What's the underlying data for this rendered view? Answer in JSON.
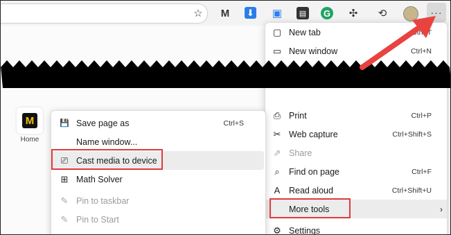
{
  "toolbar": {
    "icons": [
      {
        "name": "star-add-icon",
        "glyph": "☆"
      },
      {
        "name": "mail-icon",
        "glyph": "M"
      },
      {
        "name": "download-ext-icon",
        "glyph": "⬇"
      },
      {
        "name": "screenshot-ext-icon",
        "glyph": "▣"
      },
      {
        "name": "dark-ext-icon",
        "glyph": "▤"
      },
      {
        "name": "grammarly-icon",
        "glyph": "G"
      },
      {
        "name": "extensions-icon",
        "glyph": "✣"
      },
      {
        "name": "history-icon",
        "glyph": "⟲"
      }
    ],
    "more_label": "···"
  },
  "home_tile": {
    "glyph": "M",
    "label": "Home"
  },
  "main_menu": {
    "items": [
      {
        "icon": "▢",
        "label": "New tab",
        "shortcut": "Ctrl+T",
        "disabled": false
      },
      {
        "icon": "▭",
        "label": "New window",
        "shortcut": "Ctrl+N",
        "disabled": false
      },
      {
        "icon": "⎙",
        "label": "Print",
        "shortcut": "Ctrl+P",
        "disabled": false
      },
      {
        "icon": "✂",
        "label": "Web capture",
        "shortcut": "Ctrl+Shift+S",
        "disabled": false
      },
      {
        "icon": "⇗",
        "label": "Share",
        "shortcut": "",
        "disabled": true
      },
      {
        "icon": "⌕",
        "label": "Find on page",
        "shortcut": "Ctrl+F",
        "disabled": false
      },
      {
        "icon": "A",
        "label": "Read aloud",
        "shortcut": "Ctrl+Shift+U",
        "disabled": false
      },
      {
        "icon": "",
        "label": "More tools",
        "shortcut": "",
        "disabled": false
      },
      {
        "icon": "⚙",
        "label": "Settings",
        "shortcut": "",
        "disabled": false
      }
    ],
    "more_tools_chevron": "›"
  },
  "sub_menu": {
    "items": [
      {
        "icon": "💾",
        "label": "Save page as",
        "shortcut": "Ctrl+S",
        "disabled": false
      },
      {
        "icon": "",
        "label": "Name window...",
        "shortcut": "",
        "disabled": false
      },
      {
        "icon": "⎚",
        "label": "Cast media to device",
        "shortcut": "",
        "disabled": false
      },
      {
        "icon": "⊞",
        "label": "Math Solver",
        "shortcut": "",
        "disabled": false
      },
      {
        "icon": "✎",
        "label": "Pin to taskbar",
        "shortcut": "",
        "disabled": true
      },
      {
        "icon": "✎",
        "label": "Pin to Start",
        "shortcut": "",
        "disabled": true
      }
    ]
  },
  "colors": {
    "highlight_red": "#e03a3e",
    "arrow_red": "#e8433f"
  }
}
